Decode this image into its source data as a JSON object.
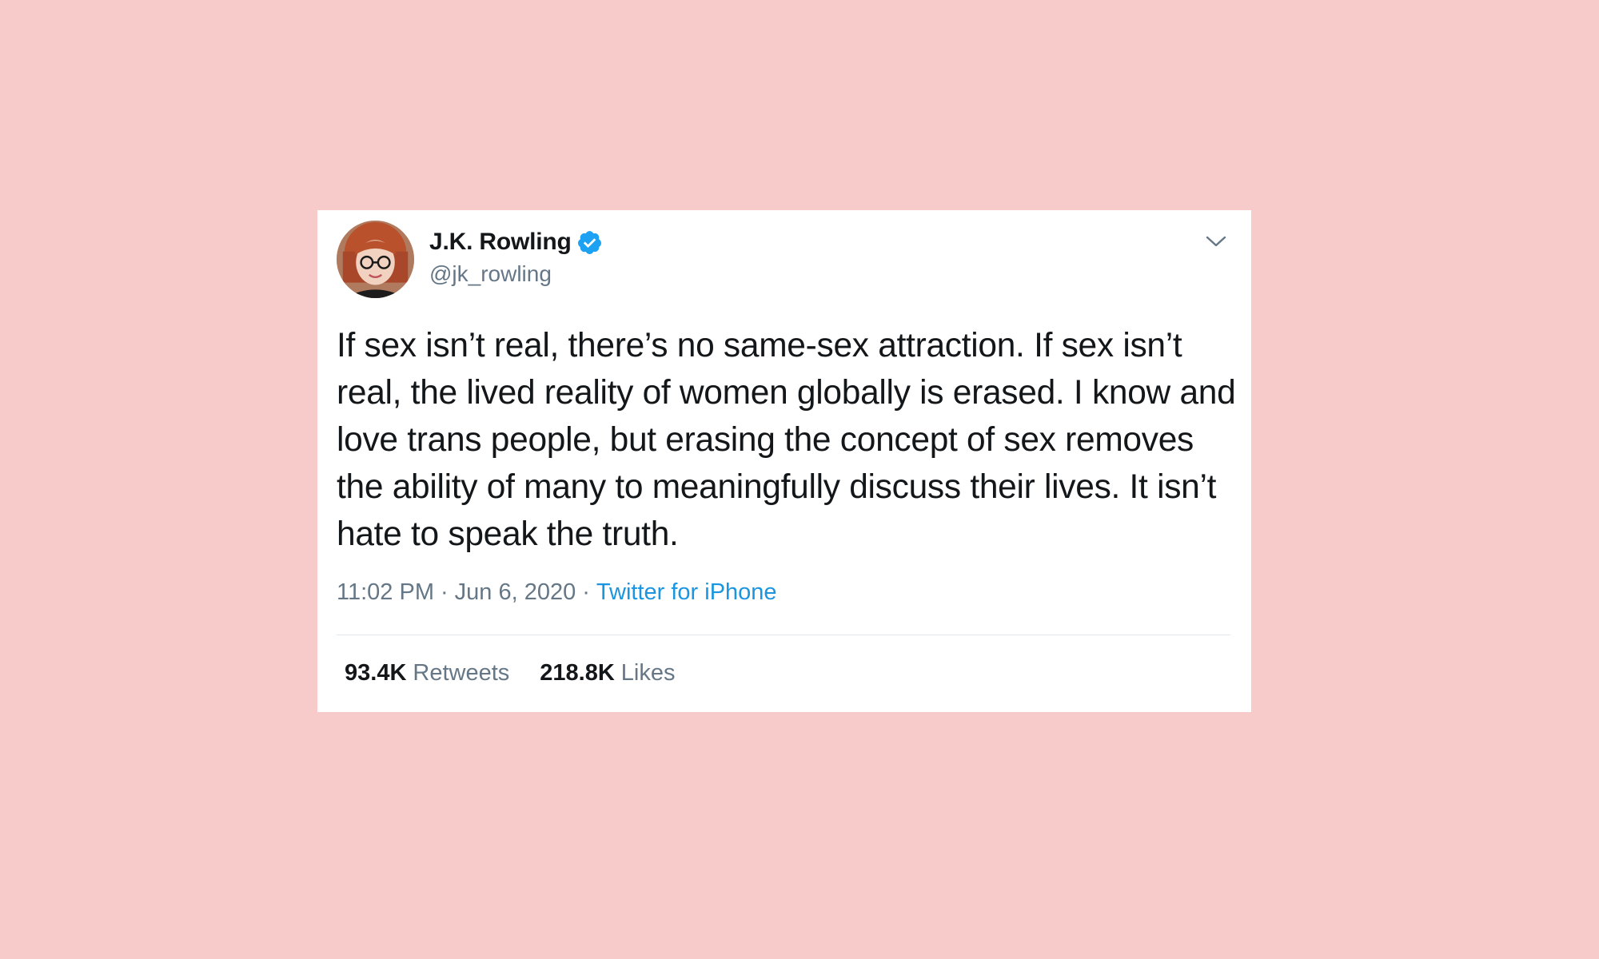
{
  "tweet": {
    "author": {
      "display_name": "J.K. Rowling",
      "handle": "@jk_rowling",
      "verified": true,
      "avatar_icon": "profile-photo"
    },
    "text": "If sex isn’t real, there’s no same-sex attraction. If sex isn’t real, the lived reality of women globally is erased. I know and love trans people, but erasing the concept of sex removes the ability of many to meaningfully discuss their lives. It isn’t hate to speak the truth.",
    "time": "11:02 PM",
    "date": "Jun 6, 2020",
    "separator": "·",
    "source": "Twitter for iPhone",
    "stats": {
      "retweets_count": "93.4K",
      "retweets_label": "Retweets",
      "likes_count": "218.8K",
      "likes_label": "Likes"
    },
    "menu_icon": "chevron-down-icon"
  },
  "colors": {
    "background": "#f7cbc9",
    "card": "#ffffff",
    "text_primary": "#14171a",
    "text_secondary": "#657786",
    "link": "#1b95e0",
    "verified_badge": "#1da1f2"
  }
}
